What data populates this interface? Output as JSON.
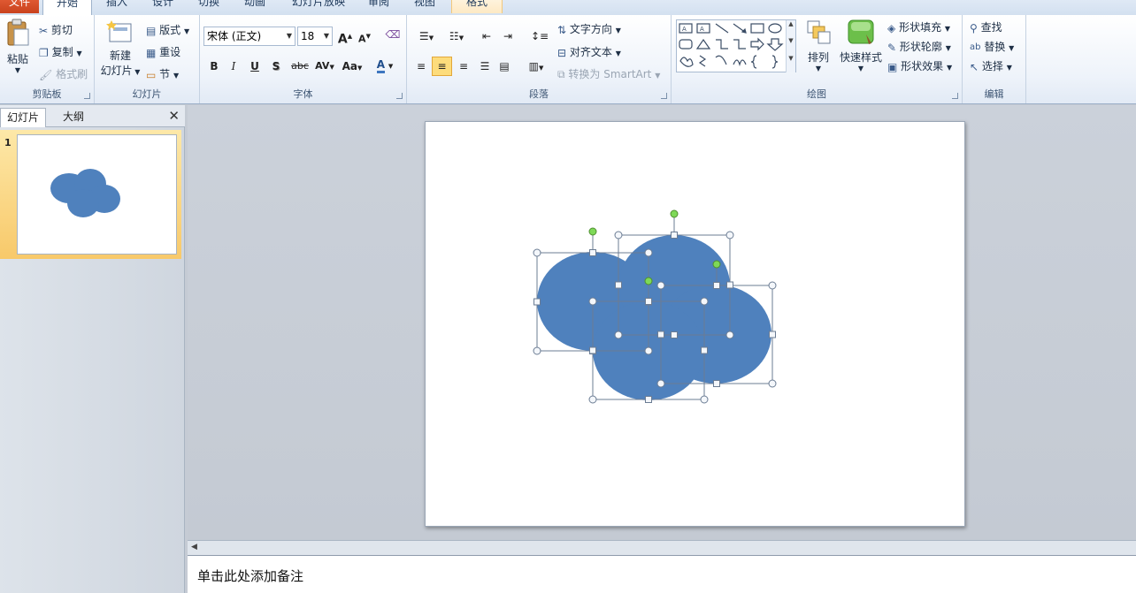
{
  "tabs": [
    "文件",
    "开始",
    "插入",
    "设计",
    "切换",
    "动画",
    "幻灯片放映",
    "审阅",
    "视图",
    "格式"
  ],
  "clipboard": {
    "paste": "粘贴",
    "cut": "剪切",
    "copy": "复制",
    "format_painter": "格式刷",
    "label": "剪贴板"
  },
  "slides_group": {
    "new_slide_1": "新建",
    "new_slide_2": "幻灯片",
    "layout": "版式",
    "reset": "重设",
    "section": "节",
    "label": "幻灯片"
  },
  "font": {
    "name": "宋体 (正文)",
    "size": "18",
    "label": "字体",
    "bold": "B",
    "italic": "I",
    "underline": "U",
    "shadow": "S",
    "strike": "abc",
    "spacing": "AV",
    "case": "Aa",
    "color": "A",
    "grow": "A",
    "shrink": "A"
  },
  "paragraph": {
    "text_direction": "文字方向",
    "align_text": "对齐文本",
    "smartart": "转换为 SmartArt",
    "label": "段落"
  },
  "drawing": {
    "arrange": "排列",
    "quick_styles": "快速样式",
    "fill": "形状填充",
    "outline": "形状轮廓",
    "effects": "形状效果",
    "label": "绘图"
  },
  "editing": {
    "find": "查找",
    "replace": "替换",
    "select": "选择",
    "label": "编辑"
  },
  "left_panel": {
    "tab_slides": "幻灯片",
    "tab_outline": "大纲",
    "slide_number": "1"
  },
  "notes_placeholder": "单击此处添加备注",
  "colors": {
    "shape_fill": "#4f81bd",
    "handle_green": "#7ed957",
    "selection_line": "#6b7c93"
  }
}
